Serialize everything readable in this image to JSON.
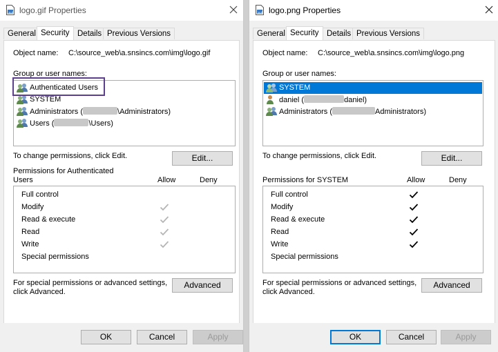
{
  "left": {
    "title": "logo.gif Properties",
    "tabs": [
      "General",
      "Security",
      "Details",
      "Previous Versions"
    ],
    "active_tab": "Security",
    "object_label": "Object name:",
    "object_value": "C:\\source_web\\a.snsincs.com\\img\\logo.gif",
    "groups_label": "Group or user names:",
    "users": [
      {
        "name": "Authenticated Users",
        "pre": "",
        "post": ""
      },
      {
        "name": "SYSTEM",
        "pre": "",
        "post": ""
      },
      {
        "name": "",
        "pre": "Administrators (",
        "post": "\\Administrators)"
      },
      {
        "name": "",
        "pre": "Users (",
        "post": "\\Users)"
      }
    ],
    "change_text": "To change permissions, click Edit.",
    "edit_label": "Edit...",
    "perm_for_line1": "Permissions for Authenticated",
    "perm_for_line2": "Users",
    "allow_label": "Allow",
    "deny_label": "Deny",
    "permissions": [
      {
        "name": "Full control",
        "allow": false
      },
      {
        "name": "Modify",
        "allow": true
      },
      {
        "name": "Read & execute",
        "allow": true
      },
      {
        "name": "Read",
        "allow": true
      },
      {
        "name": "Write",
        "allow": true
      },
      {
        "name": "Special permissions",
        "allow": false
      }
    ],
    "check_color": "#b5b5b5",
    "special_line1": "For special permissions or advanced settings,",
    "special_line2": "click Advanced.",
    "advanced_label": "Advanced",
    "ok_label": "OK",
    "cancel_label": "Cancel",
    "apply_label": "Apply"
  },
  "right": {
    "title": "logo.png Properties",
    "tabs": [
      "General",
      "Security",
      "Details",
      "Previous Versions"
    ],
    "active_tab": "Security",
    "object_label": "Object name:",
    "object_value": "C:\\source_web\\a.snsincs.com\\img\\logo.png",
    "groups_label": "Group or user names:",
    "users": [
      {
        "name": "SYSTEM",
        "pre": "",
        "post": ""
      },
      {
        "name": "",
        "pre": "daniel (",
        "post": "daniel)"
      },
      {
        "name": "",
        "pre": "Administrators (",
        "post": "Administrators)"
      }
    ],
    "change_text": "To change permissions, click Edit.",
    "edit_label": "Edit...",
    "perm_for_line1": "Permissions for SYSTEM",
    "perm_for_line2": "",
    "allow_label": "Allow",
    "deny_label": "Deny",
    "permissions": [
      {
        "name": "Full control",
        "allow": true
      },
      {
        "name": "Modify",
        "allow": true
      },
      {
        "name": "Read & execute",
        "allow": true
      },
      {
        "name": "Read",
        "allow": true
      },
      {
        "name": "Write",
        "allow": true
      },
      {
        "name": "Special permissions",
        "allow": false
      }
    ],
    "check_color": "#000000",
    "special_line1": "For special permissions or advanced settings,",
    "special_line2": "click Advanced.",
    "advanced_label": "Advanced",
    "ok_label": "OK",
    "cancel_label": "Cancel",
    "apply_label": "Apply"
  },
  "icons": {
    "file": "file-icon",
    "close": "close-icon",
    "users": "users-group-icon",
    "user": "user-icon",
    "check": "checkmark-icon"
  }
}
